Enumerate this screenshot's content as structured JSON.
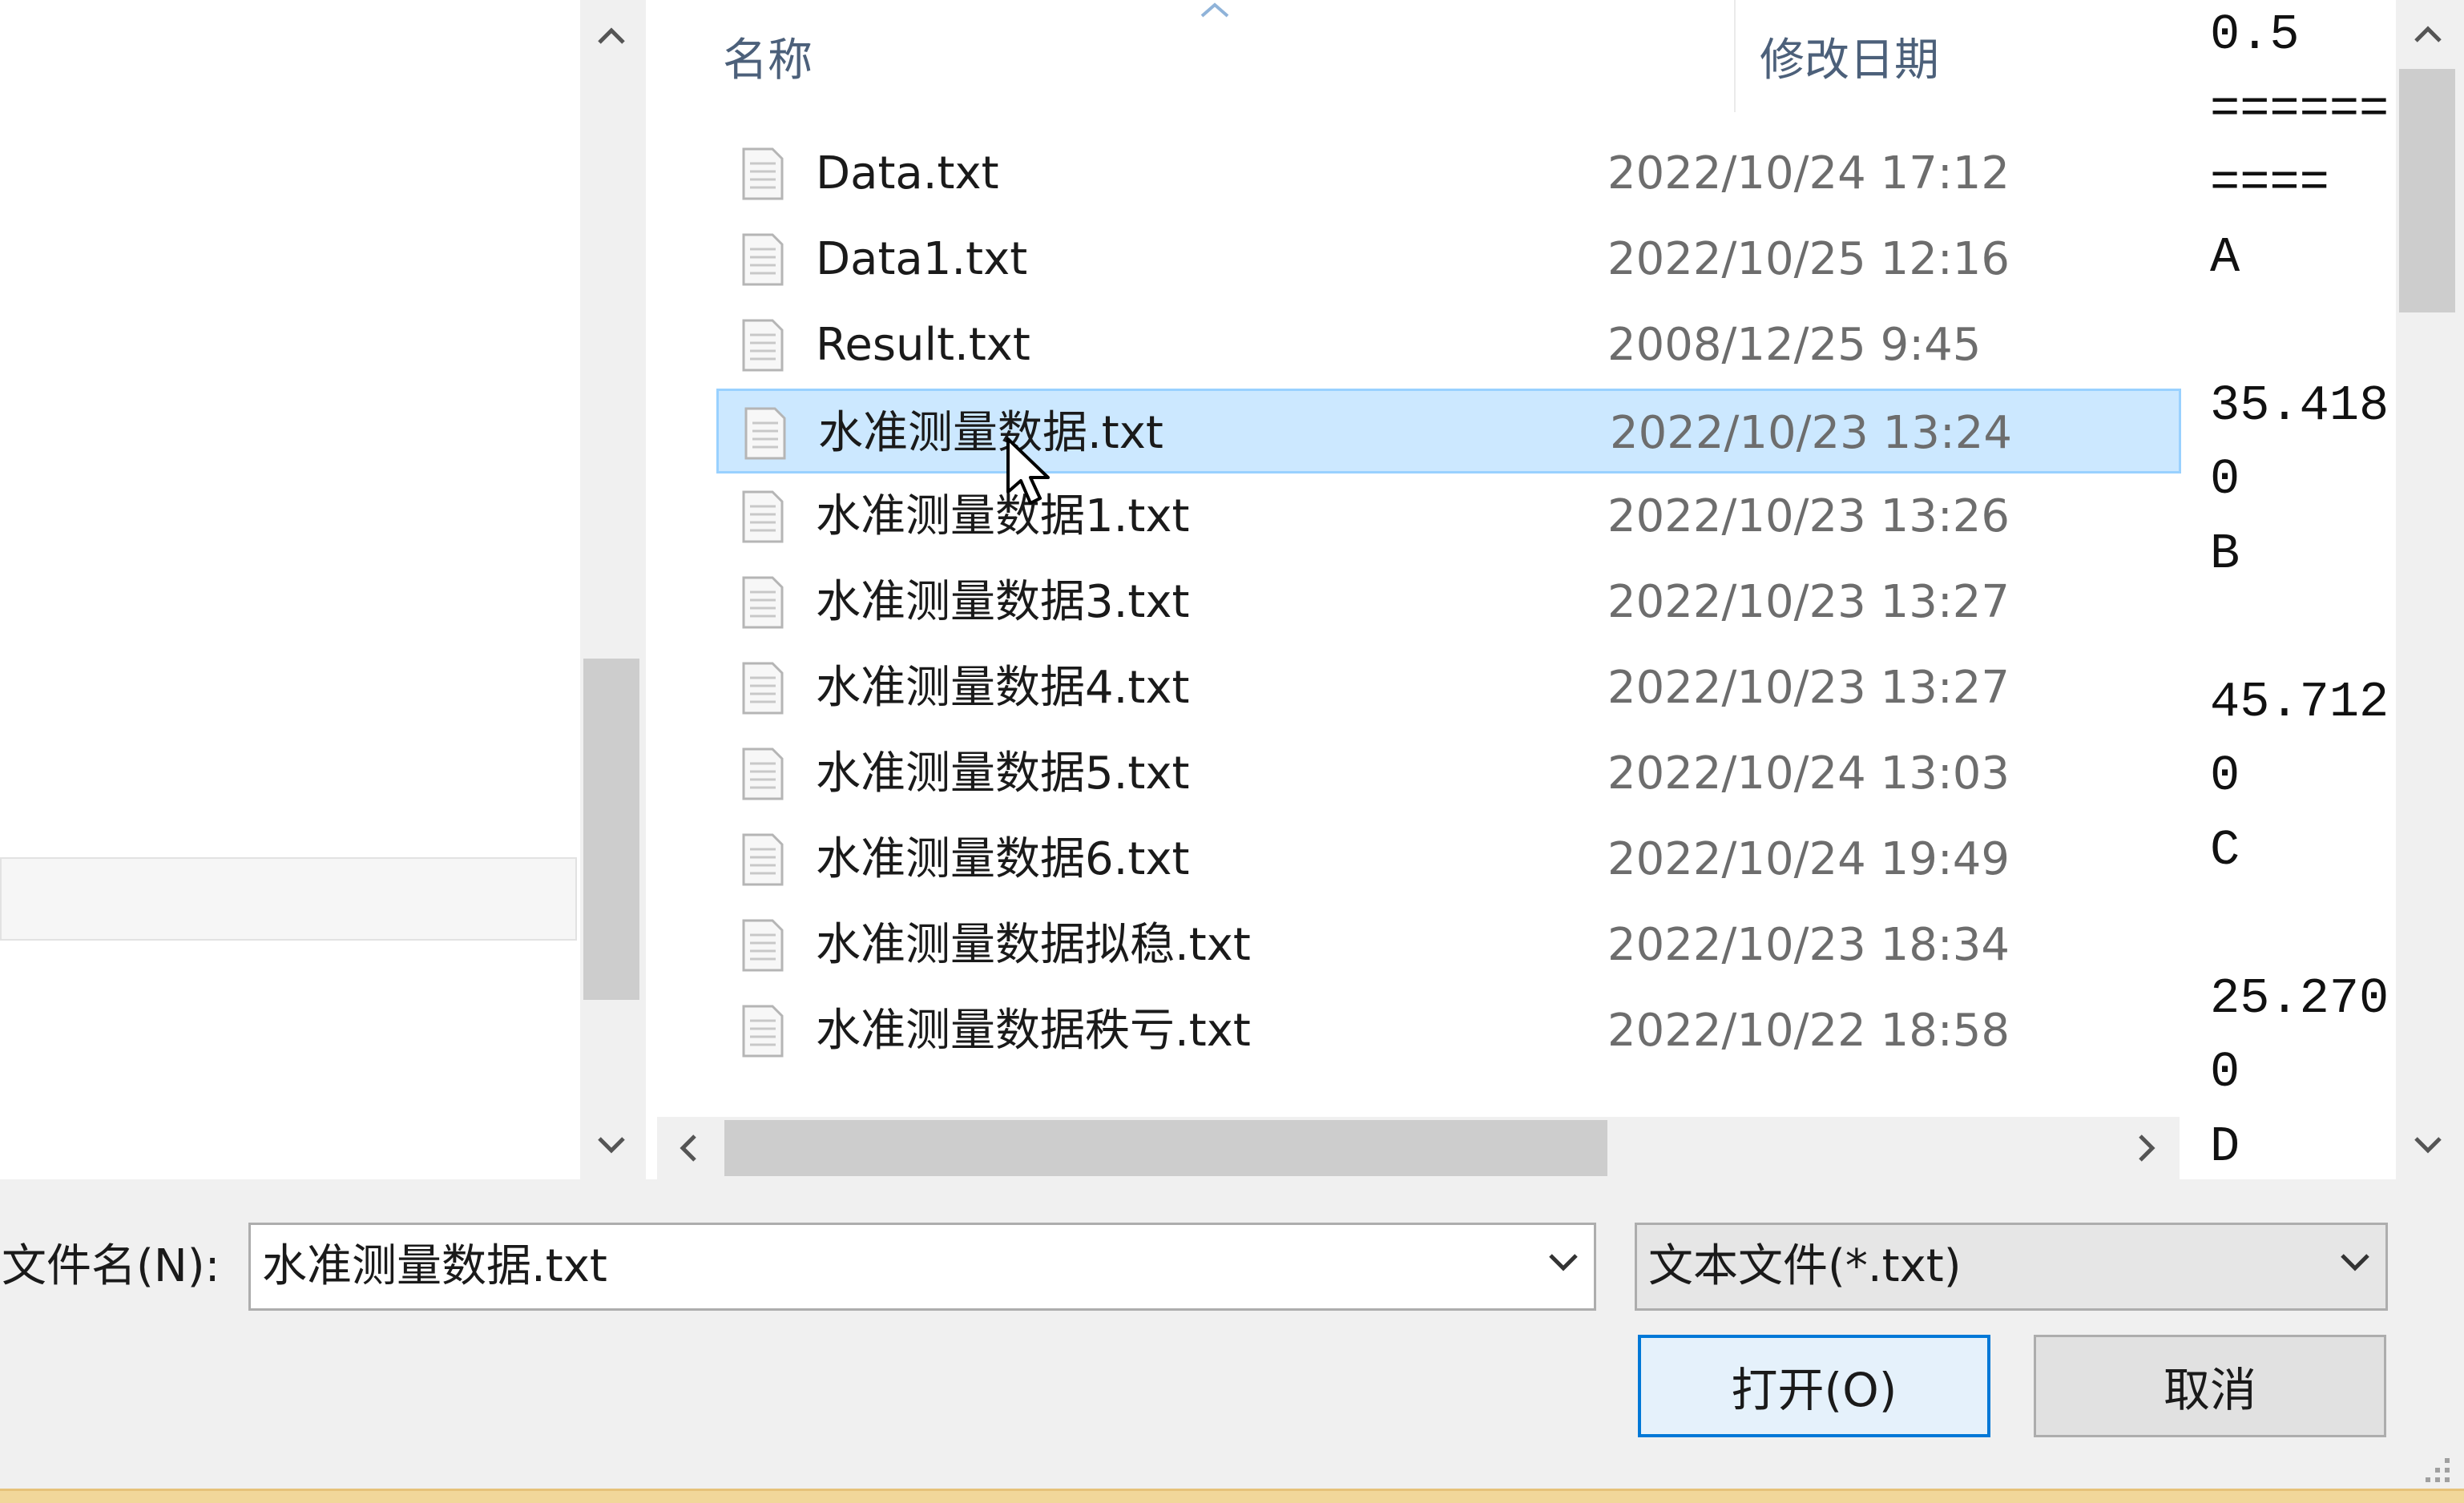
{
  "columns": {
    "name": "名称",
    "modified": "修改日期"
  },
  "files": [
    {
      "name": "Data.txt",
      "date": "2022/10/24 17:12",
      "selected": false
    },
    {
      "name": "Data1.txt",
      "date": "2022/10/25 12:16",
      "selected": false
    },
    {
      "name": "Result.txt",
      "date": "2008/12/25 9:45",
      "selected": false
    },
    {
      "name": "水准测量数据.txt",
      "date": "2022/10/23 13:24",
      "selected": true
    },
    {
      "name": "水准测量数据1.txt",
      "date": "2022/10/23 13:26",
      "selected": false
    },
    {
      "name": "水准测量数据3.txt",
      "date": "2022/10/23 13:27",
      "selected": false
    },
    {
      "name": "水准测量数据4.txt",
      "date": "2022/10/23 13:27",
      "selected": false
    },
    {
      "name": "水准测量数据5.txt",
      "date": "2022/10/24 13:03",
      "selected": false
    },
    {
      "name": "水准测量数据6.txt",
      "date": "2022/10/24 19:49",
      "selected": false
    },
    {
      "name": "水准测量数据拟稳.txt",
      "date": "2022/10/23 18:34",
      "selected": false
    },
    {
      "name": "水准测量数据秩亏.txt",
      "date": "2022/10/22 18:58",
      "selected": false
    }
  ],
  "preview": {
    "lines": [
      "0.5",
      "======",
      "====",
      "A",
      "",
      "35.418",
      "0",
      "B",
      "",
      "45.712",
      "0",
      "C",
      "",
      "25.270",
      "0",
      "D"
    ]
  },
  "footer": {
    "filename_label": "文件名(N):",
    "filename_value": "水准测量数据.txt",
    "filetype_value": "文本文件(*.txt)",
    "open_button": "打开(O)",
    "cancel_button": "取消"
  }
}
